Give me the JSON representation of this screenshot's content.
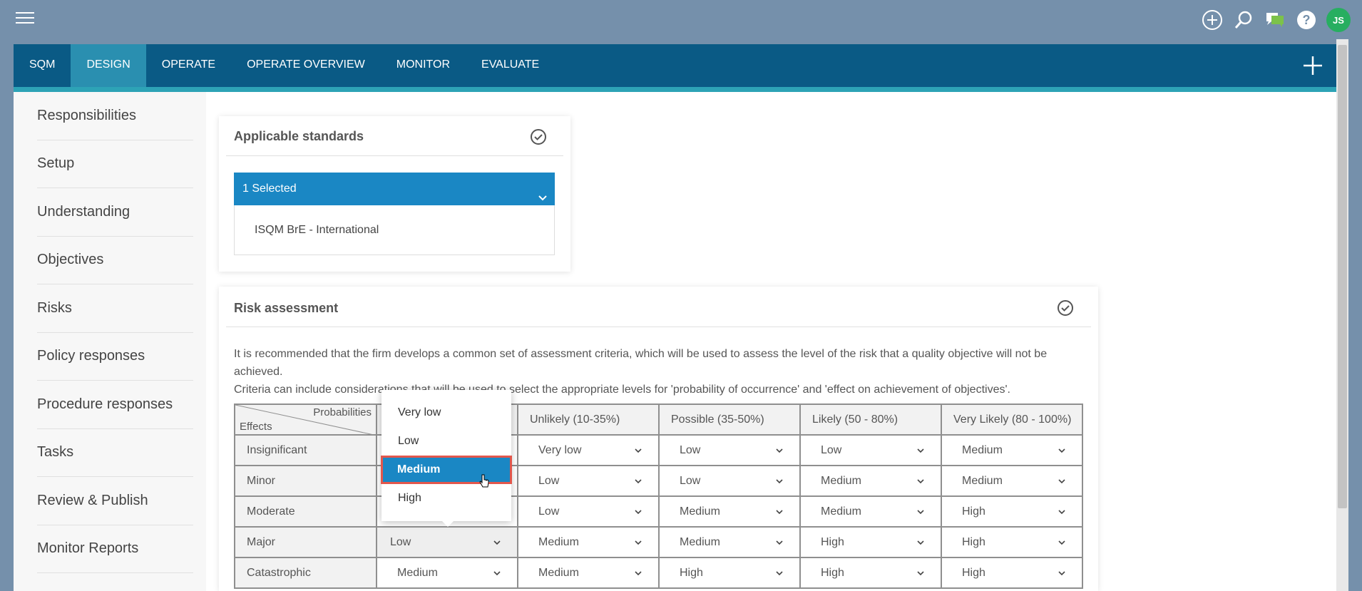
{
  "header": {
    "avatar_initials": "JS",
    "icons": [
      "add-circle-icon",
      "search-icon",
      "chat-icon",
      "help-icon"
    ]
  },
  "nav": {
    "tabs": [
      {
        "label": "SQM",
        "active": false
      },
      {
        "label": "DESIGN",
        "active": true
      },
      {
        "label": "OPERATE",
        "active": false
      },
      {
        "label": "OPERATE OVERVIEW",
        "active": false
      },
      {
        "label": "MONITOR",
        "active": false
      },
      {
        "label": "EVALUATE",
        "active": false
      }
    ]
  },
  "sidebar": {
    "items": [
      {
        "label": "Responsibilities"
      },
      {
        "label": "Setup"
      },
      {
        "label": "Understanding"
      },
      {
        "label": "Objectives"
      },
      {
        "label": "Risks"
      },
      {
        "label": "Policy responses"
      },
      {
        "label": "Procedure responses"
      },
      {
        "label": "Tasks"
      },
      {
        "label": "Review & Publish"
      },
      {
        "label": "Monitor Reports"
      }
    ]
  },
  "standards": {
    "title": "Applicable standards",
    "selected_label": "1 Selected",
    "items": [
      "ISQM BrE - International"
    ]
  },
  "risk": {
    "title": "Risk assessment",
    "desc_line1": "It is recommended that the firm develops a common set of assessment criteria, which will be used to assess the level of the risk that a quality objective will not be achieved.",
    "desc_line2": "Criteria can include considerations that will be used to select the appropriate levels for 'probability of occurrence' and 'effect on achievement of objectives'.",
    "corner_top": "Probabilities",
    "corner_bottom": "Effects",
    "columns": [
      "",
      "Unlikely (10-35%)",
      "Possible (35-50%)",
      "Likely (50 - 80%)",
      "Very Likely (80 - 100%)"
    ],
    "rows": [
      {
        "label": "Insignificant",
        "values": [
          "",
          "Very low",
          "Low",
          "Low",
          "Medium"
        ]
      },
      {
        "label": "Minor",
        "values": [
          "",
          "Low",
          "Low",
          "Medium",
          "Medium"
        ]
      },
      {
        "label": "Moderate",
        "values": [
          "",
          "Low",
          "Medium",
          "Medium",
          "High"
        ]
      },
      {
        "label": "Major",
        "values": [
          "Low",
          "Medium",
          "Medium",
          "High",
          "High"
        ]
      },
      {
        "label": "Catastrophic",
        "values": [
          "Medium",
          "Medium",
          "High",
          "High",
          "High"
        ]
      }
    ]
  },
  "dropdown": {
    "options": [
      "Very low",
      "Low",
      "Medium",
      "High"
    ],
    "highlighted": "Medium"
  },
  "colors": {
    "nav_bg": "#0a5a85",
    "nav_active": "#2a8fb0",
    "accent": "#1a87c4",
    "highlight_border": "#e2574c",
    "avatar": "#27ae60"
  }
}
